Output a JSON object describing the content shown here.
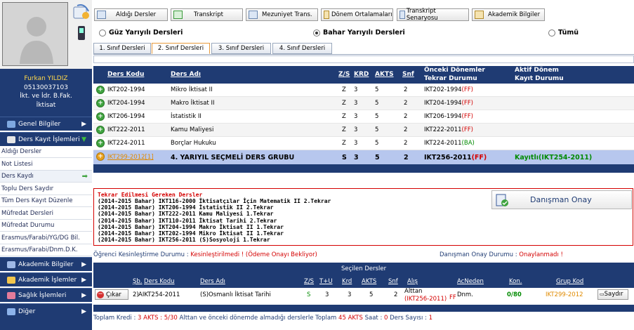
{
  "student": {
    "name": "Furkan YILDIZ",
    "number": "05130037103",
    "faculty": "İkt. ve İdr. B.Fak.",
    "department": "İktisat"
  },
  "menu": {
    "general": "Genel Bilgiler",
    "course_reg": "Ders Kayıt İşlemleri",
    "academic": "Akademik Bilgiler",
    "academic_ops": "Akademik İşlemler",
    "health": "Sağlık İşlemleri",
    "other": "Diğer"
  },
  "submenu": [
    "Aldığı Dersler",
    "Not Listesi",
    "Ders Kaydı",
    "Toplu Ders Saydır",
    "Tüm Ders Kayıt Düzenle",
    "Müfredat Dersleri",
    "Müfredat Durumu",
    "Erasmus/Farabi/YG/DG Bil.",
    "Erasmus/Farabi/Dnm.D.K."
  ],
  "toolbar": [
    "Aldığı Dersler",
    "Transkript",
    "Mezuniyet Trans.",
    "Dönem Ortalamaları",
    "Transkript Senaryosu",
    "Akademik Bilgiler"
  ],
  "semesters": {
    "fall": "Güz Yarıyılı Dersleri",
    "spring": "Bahar Yarıyılı Dersleri",
    "all": "Tümü"
  },
  "tabs": [
    "1. Sınıf Dersleri",
    "2. Sınıf Dersleri",
    "3. Sınıf Dersleri",
    "4. Sınıf Dersleri"
  ],
  "table_header": {
    "code": "Ders Kodu",
    "name": "Ders Adı",
    "zs": "Z/S",
    "krd": "KRD",
    "akts": "AKTS",
    "snf": "Snf",
    "prev1": "Önceki Dönemler",
    "prev2": "Tekrar Durumu",
    "act1": "Aktif Dönem",
    "act2": "Kayıt Durumu"
  },
  "courses": [
    {
      "code": "IKT202-1994",
      "name": "Mikro İktisat II",
      "zs": "Z",
      "krd": "3",
      "akts": "5",
      "snf": "2",
      "prev": "IKT202-1994",
      "prev_status": "(FF)",
      "active": "",
      "active_code": ""
    },
    {
      "code": "IKT204-1994",
      "name": "Makro İktisat II",
      "zs": "Z",
      "krd": "3",
      "akts": "5",
      "snf": "2",
      "prev": "IKT204-1994",
      "prev_status": "(FF)",
      "active": "",
      "active_code": ""
    },
    {
      "code": "IKT206-1994",
      "name": "İstatistik II",
      "zs": "Z",
      "krd": "3",
      "akts": "5",
      "snf": "2",
      "prev": "IKT206-1994",
      "prev_status": "(FF)",
      "active": "",
      "active_code": ""
    },
    {
      "code": "IKT222-2011",
      "name": "Kamu Maliyesi",
      "zs": "Z",
      "krd": "3",
      "akts": "5",
      "snf": "2",
      "prev": "IKT222-2011",
      "prev_status": "(FF)",
      "active": "",
      "active_code": ""
    },
    {
      "code": "IKT224-2011",
      "name": "Borçlar Hukuku",
      "zs": "Z",
      "krd": "3",
      "akts": "5",
      "snf": "2",
      "prev": "IKT224-2011",
      "prev_status": "(BA)",
      "active": "",
      "active_code": ""
    },
    {
      "code": "IKT299-2012[1]",
      "name": "4. YARIYIL SEÇMELİ DERS GRUBU",
      "zs": "S",
      "krd": "3",
      "akts": "5",
      "snf": "2",
      "prev": "IKT256-2011",
      "prev_status": "(FF)",
      "active": "Kayıtlı",
      "active_code": "(IKT254-2011)"
    }
  ],
  "repeat": {
    "title": "Tekrar Edilmesi Gereken Dersler",
    "lines": [
      "(2014-2015 Bahar) IKT116-2000 İktisatçılar İçin Matematik II 2.Tekrar",
      "(2014-2015 Bahar) IKT206-1994 İstatistik II 2.Tekrar",
      "(2014-2015 Bahar) IKT222-2011 Kamu Maliyesi 1.Tekrar",
      "(2014-2015 Bahar) IKT110-2011 İktisat Tarihi 2.Tekrar",
      "(2014-2015 Bahar) IKT204-1994 Makro İktisat II 1.Tekrar",
      "(2014-2015 Bahar) IKT202-1994 Mikro İktisat II 1.Tekrar",
      "(2014-2015 Bahar) IKT256-2011 (S)Sosyoloji 1.Tekrar"
    ],
    "advisor_button": "Danışman Onay"
  },
  "status": {
    "student_label": "Öğrenci Kesinleştirme Durumu :",
    "student_value": "Kesinleştirilmedi !",
    "student_pending": "(Ödeme Onayı Bekliyor)",
    "advisor_label": "Danışman Onay Durumu :",
    "advisor_value": "Onaylanmadı !"
  },
  "selected": {
    "title": "Seçilen Dersler",
    "headers": {
      "sb": "Şb.",
      "code": "Ders Kodu",
      "name": "Ders Adı",
      "zs": "Z/S",
      "tu": "T+U",
      "krd": "Krd",
      "akts": "AKTS",
      "snf": "Snf",
      "alis": "Alış",
      "acneden": "AcNeden",
      "kon": "Kon.",
      "grup": "Grup Kod"
    },
    "row": {
      "remove": "Çıkar",
      "sb": "2)",
      "code": "AIKT254-2011",
      "name": "(S)Osmanlı İktisat Tarihi",
      "zs": "S",
      "tu": "3",
      "krd": "3",
      "akts": "5",
      "snf": "2",
      "alis1": "Alttan",
      "alis2": "(IKT256-2011)",
      "alis3": "FF",
      "acneden": "Dnm.",
      "kon": "0/80",
      "grup": "IKT299-2012",
      "saydir": "Saydır"
    }
  },
  "footer": {
    "p1": "Toplam Kredi :",
    "v1": "3 AKTS :",
    "v2": "5/30",
    "p2": "Alttan ve önceki dönemde almadığı derslerle Toplam",
    "v3": "45 AKTS",
    "p3": "Saat :",
    "v4": "0",
    "p4": "Ders Sayısı :",
    "v5": "1"
  },
  "colors": {
    "navy": "#1f3b73",
    "red": "#d40000",
    "green": "#008a00",
    "orange": "#e08a00"
  }
}
